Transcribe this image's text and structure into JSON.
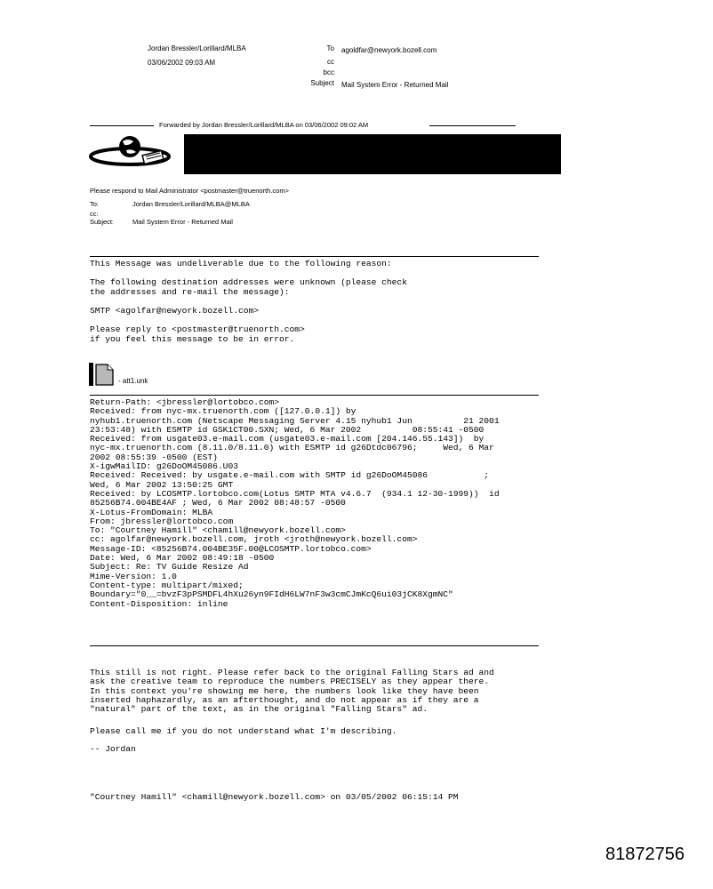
{
  "header": {
    "sender": "Jordan Bressler/Lorillard/MLBA",
    "date": "03/06/2002 09:03 AM",
    "to_label": "To",
    "to_value": "agoldfar@newyork.bozell.com",
    "cc_label": "cc",
    "bcc_label": "bcc",
    "subject_label": "Subject",
    "subject_value": "Mail System Error - Returned Mail"
  },
  "forwarded": "Forwarded by Jordan Bressler/Lorillard/MLBA on 03/06/2002 09:02 AM",
  "logo_icon": "globe-plug-logo-icon",
  "redaction_color": "#000000",
  "admin": {
    "respond": "Please respond to Mail Administrator <postmaster@truenorth.com>",
    "to_label": "To:",
    "to_value": "Jordan Bressler/Lorillard/MLBA@MLBA",
    "cc_label": "cc:",
    "subject_label": "Subject:",
    "subject_value": "Mail System Error - Returned Mail"
  },
  "error_body": {
    "line1": "This Message was undeliverable due to the following reason:",
    "para2": "The following destination addresses were unknown (please check\nthe addresses and re-mail the message):",
    "smtp": "SMTP <agolfar@newyork.bozell.com>",
    "para4": "Please reply to <postmaster@truenorth.com>\nif you feel this message to be in error."
  },
  "attachment": {
    "icon": "document-attachment-icon",
    "label": "- att1.unk"
  },
  "headers_block": "Return-Path: <jbressler@lortobco.com>\nReceived: from nyc-mx.truenorth.com ([127.0.0.1]) by\nnyhub1.truenorth.com (Netscape Messaging Server 4.15 nyhub1 Jun          21 2001\n23:53:48) with ESMTP id GSK1CT00.SXN; Wed, 6 Mar 2002          08:55:41 -0500\nReceived: from usgate03.e-mail.com (usgate03.e-mail.com [204.146.55.143])  by\nnyc-mx.truenorth.com (8.11.0/8.11.0) with ESMTP id g26Dtdc06796;     Wed, 6 Mar\n2002 08:55:39 -0500 (EST)\nX-igwMailID: g26DoOM45086.U03\nReceived: Received: by usgate.e-mail.com with SMTP id g26DoOM45086           ;\nWed, 6 Mar 2002 13:50:25 GMT\nReceived: by LCOSMTP.lortobco.com(Lotus SMTP MTA v4.6.7  (934.1 12-30-1999))  id\n85256B74.004BE4AF ; Wed, 6 Mar 2002 08:48:57 -0500\nX-Lotus-FromDomain: MLBA\nFrom: jbressler@lortobco.com\nTo: \"Courtney Hamill\" <chamill@newyork.bozell.com>\ncc: agolfar@newyork.bozell.com, jroth <jroth@newyork.bozell.com>\nMessage-ID: <85256B74.004BE35F.00@LCOSMTP.lortobco.com>\nDate: Wed, 6 Mar 2002 08:49:18 -0500\nSubject: Re: TV Guide Resize Ad\nMime-Version: 1.0\nContent-type: multipart/mixed;\nBoundary=\"0__=bvzF3pPSMDFL4hXu26yn9FIdH6LW7nF3w3cmCJmKcQ6ui03jCK8XgmNC\"\nContent-Disposition: inline",
  "message": {
    "para1": "This still is not right. Please refer back to the original Falling Stars ad and\nask the creative team to reproduce the numbers PRECISELY as they appear there.\nIn this context you're showing me here, the numbers look like they have been\ninserted haphazardly, as an afterthought, and do not appear as if they are a\n\"natural\" part of the text, as in the original \"Falling Stars\" ad.",
    "para2": "Please call me if you do not understand what I'm describing.",
    "signoff": "-- Jordan",
    "quote_line": "\"Courtney Hamill\" <chamill@newyork.bozell.com> on 03/05/2002 06:15:14 PM"
  },
  "doc_number": "81872756"
}
